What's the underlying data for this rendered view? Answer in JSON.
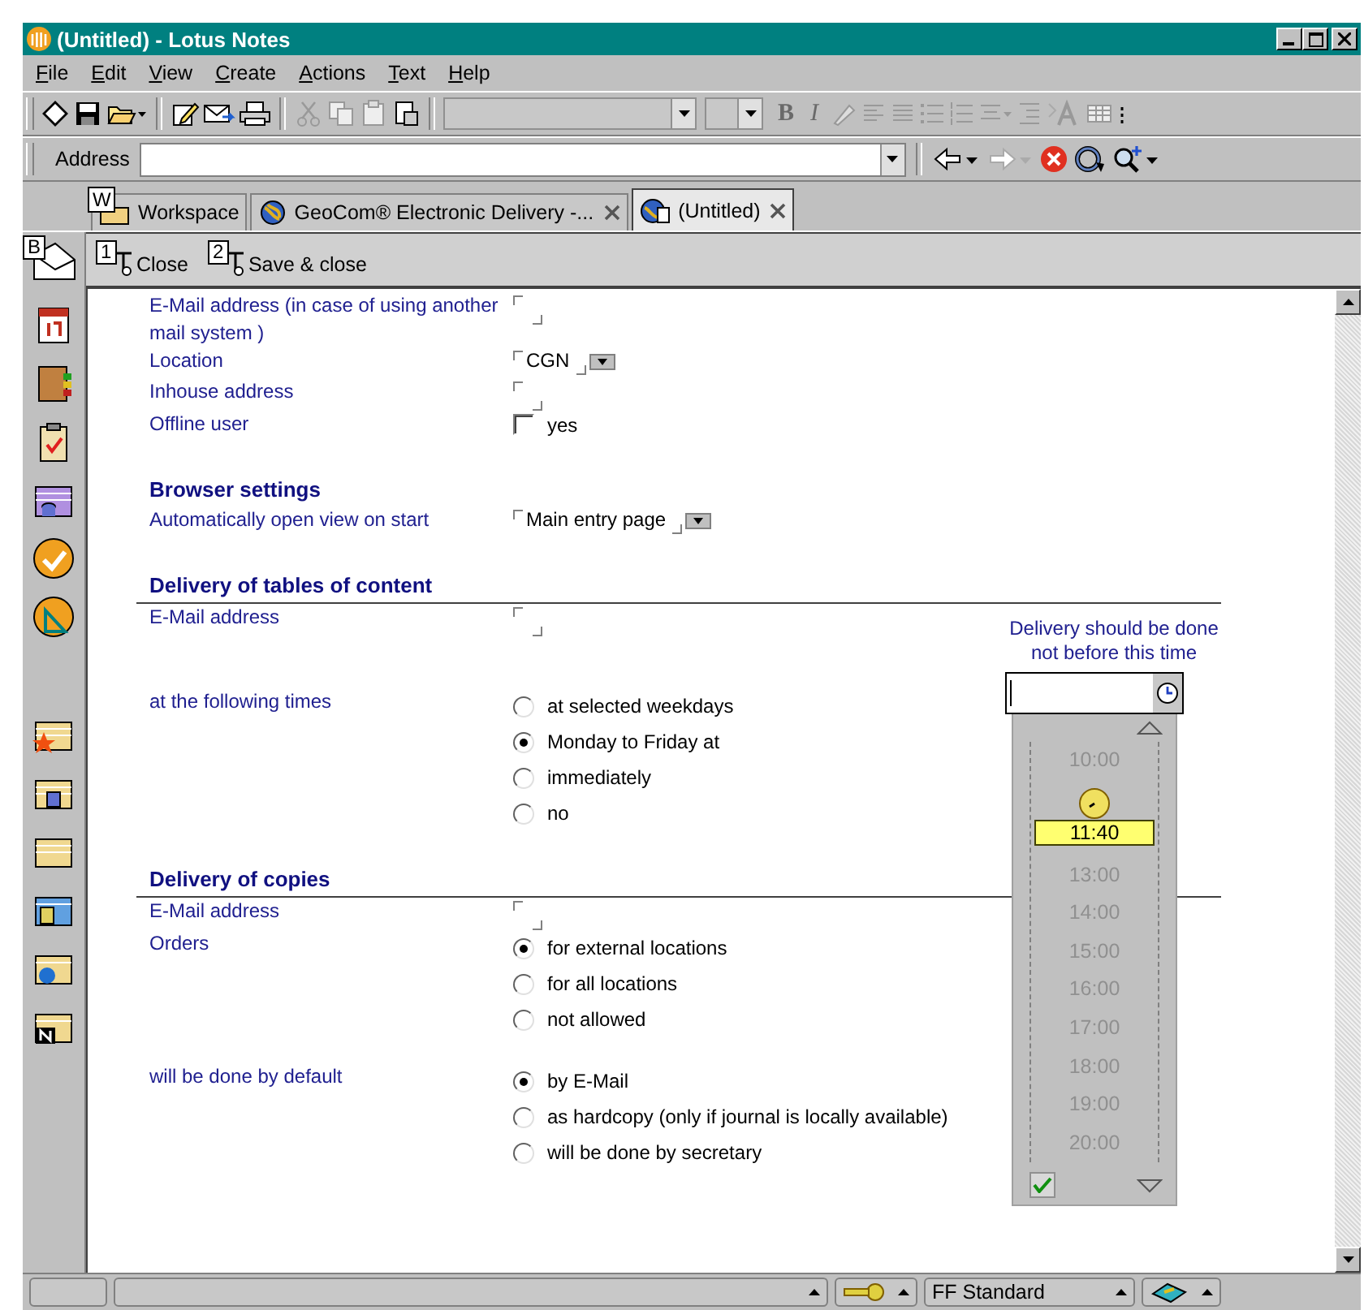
{
  "window": {
    "title": "(Untitled) - Lotus Notes"
  },
  "menu": [
    {
      "label": "File"
    },
    {
      "label": "Edit"
    },
    {
      "label": "View"
    },
    {
      "label": "Create"
    },
    {
      "label": "Actions"
    },
    {
      "label": "Text"
    },
    {
      "label": "Help"
    }
  ],
  "toolbar": {
    "format_labels": [
      "B",
      "I"
    ]
  },
  "address_bar": {
    "label": "Address"
  },
  "tabs": [
    {
      "label": "Workspace",
      "selected": false,
      "closable": false,
      "hint": "W"
    },
    {
      "label": "GeoCom® Electronic Delivery -...",
      "selected": false,
      "closable": true
    },
    {
      "label": "(Untitled)",
      "selected": true,
      "closable": true
    }
  ],
  "sidebar": {
    "hint": "B"
  },
  "actions": [
    {
      "key": "1",
      "label": "Close"
    },
    {
      "key": "2",
      "label": "Save & close"
    }
  ],
  "sections": [
    {
      "ruled": false,
      "rows": [
        {
          "label": "E-Mail address (in case of using another mail system )",
          "kind": "text"
        },
        {
          "label": "Location",
          "kind": "dropdown",
          "value": "CGN"
        },
        {
          "label": "Inhouse address",
          "kind": "text"
        },
        {
          "label": "Offline user",
          "kind": "checkbox",
          "option": "yes",
          "checked": false
        }
      ]
    },
    {
      "heading": "Browser settings",
      "ruled": false,
      "rows": [
        {
          "label": "Automatically open view on start",
          "kind": "dropdown",
          "value": "Main entry page"
        }
      ]
    },
    {
      "heading": "Delivery of tables of content",
      "ruled": true,
      "rows": [
        {
          "label": "E-Mail address",
          "kind": "text"
        },
        {
          "label": "at the following times",
          "kind": "radio",
          "options": [
            {
              "label": "at selected weekdays",
              "selected": false
            },
            {
              "label": "Monday to Friday at",
              "selected": true
            },
            {
              "label": "immediately",
              "selected": false
            },
            {
              "label": "no",
              "selected": false
            }
          ]
        }
      ]
    },
    {
      "heading": "Delivery of copies",
      "ruled": true,
      "rows": [
        {
          "label": "E-Mail address",
          "kind": "text"
        },
        {
          "label": "Orders",
          "kind": "radio",
          "options": [
            {
              "label": "for external locations",
              "selected": true
            },
            {
              "label": "for all locations",
              "selected": false
            },
            {
              "label": "not allowed",
              "selected": false
            }
          ]
        },
        {
          "label": "will be done by default",
          "kind": "radio",
          "options": [
            {
              "label": "by E-Mail",
              "selected": true
            },
            {
              "label": "as hardcopy (only if journal is locally available)",
              "selected": false
            },
            {
              "label": "will be done by secretary",
              "selected": false
            }
          ]
        }
      ]
    }
  ],
  "time_picker": {
    "caption": "Delivery should be done not before this time",
    "times_before": [
      "10:00"
    ],
    "selected": "11:40",
    "times_after": [
      "13:00",
      "14:00",
      "15:00",
      "16:00",
      "17:00",
      "18:00",
      "19:00",
      "20:00"
    ]
  },
  "status_bar": {
    "style": "FF Standard"
  }
}
